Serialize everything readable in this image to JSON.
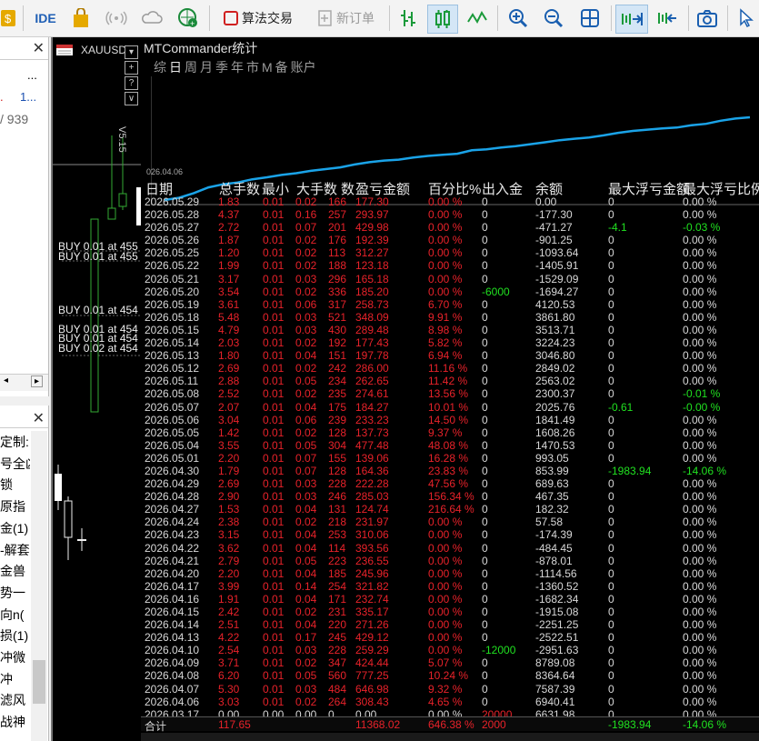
{
  "toolbar": {
    "ide": "IDE",
    "algo_trading": "算法交易",
    "new_order": "新订单"
  },
  "navigator": {
    "top_cells": [
      "...",
      "...",
      "1...",
      "1..."
    ],
    "top_fraction": "/ 939",
    "items": [
      "定制:",
      "号全凶",
      "锁",
      "原指",
      "金(1)",
      "-解套",
      "金兽",
      "势一",
      "向n(",
      "损(1)",
      "冲微",
      "冲",
      "滤风",
      "战神"
    ]
  },
  "chart": {
    "tab": "XAUUSD,H",
    "price_label": "V5.15",
    "date_label": "026.04.06",
    "orders": [
      "BUY 0.01 at 455",
      "BUY 0.01 at 455",
      "BUY 0.01 at 454",
      "BUY 0.01 at 454",
      "BUY 0.01 at 454",
      "BUY 0.02 at 454"
    ]
  },
  "stats": {
    "title": "MTCommander统计",
    "tabs": [
      "综",
      "日",
      "周",
      "月",
      "季",
      "年",
      "市",
      "M",
      "备",
      "账户"
    ],
    "active_tab": "日",
    "headers": [
      "日期",
      "总手数",
      "最小",
      "大手数",
      "数",
      "盈亏金额",
      "百分比%",
      "出入金",
      "余额",
      "最大浮亏金额",
      "最大浮亏比例"
    ],
    "rows": [
      [
        "2026.05.29",
        "1.83",
        "0.01",
        "0.02",
        "166",
        "177.30",
        "0.00 %",
        "0",
        "0.00",
        "0",
        "0.00 %"
      ],
      [
        "2026.05.28",
        "4.37",
        "0.01",
        "0.16",
        "257",
        "293.97",
        "0.00 %",
        "0",
        "-177.30",
        "0",
        "0.00 %"
      ],
      [
        "2026.05.27",
        "2.72",
        "0.01",
        "0.07",
        "201",
        "429.98",
        "0.00 %",
        "0",
        "-471.27",
        "-4.1",
        "-0.03 %"
      ],
      [
        "2026.05.26",
        "1.87",
        "0.01",
        "0.02",
        "176",
        "192.39",
        "0.00 %",
        "0",
        "-901.25",
        "0",
        "0.00 %"
      ],
      [
        "2026.05.25",
        "1.20",
        "0.01",
        "0.02",
        "113",
        "312.27",
        "0.00 %",
        "0",
        "-1093.64",
        "0",
        "0.00 %"
      ],
      [
        "2026.05.22",
        "1.99",
        "0.01",
        "0.02",
        "188",
        "123.18",
        "0.00 %",
        "0",
        "-1405.91",
        "0",
        "0.00 %"
      ],
      [
        "2026.05.21",
        "3.17",
        "0.01",
        "0.03",
        "296",
        "165.18",
        "0.00 %",
        "0",
        "-1529.09",
        "0",
        "0.00 %"
      ],
      [
        "2026.05.20",
        "3.54",
        "0.01",
        "0.02",
        "336",
        "185.20",
        "0.00 %",
        "-6000",
        "-1694.27",
        "0",
        "0.00 %"
      ],
      [
        "2026.05.19",
        "3.61",
        "0.01",
        "0.06",
        "317",
        "258.73",
        "6.70 %",
        "0",
        "4120.53",
        "0",
        "0.00 %"
      ],
      [
        "2026.05.18",
        "5.48",
        "0.01",
        "0.03",
        "521",
        "348.09",
        "9.91 %",
        "0",
        "3861.80",
        "0",
        "0.00 %"
      ],
      [
        "2026.05.15",
        "4.79",
        "0.01",
        "0.03",
        "430",
        "289.48",
        "8.98 %",
        "0",
        "3513.71",
        "0",
        "0.00 %"
      ],
      [
        "2026.05.14",
        "2.03",
        "0.01",
        "0.02",
        "192",
        "177.43",
        "5.82 %",
        "0",
        "3224.23",
        "0",
        "0.00 %"
      ],
      [
        "2026.05.13",
        "1.80",
        "0.01",
        "0.04",
        "151",
        "197.78",
        "6.94 %",
        "0",
        "3046.80",
        "0",
        "0.00 %"
      ],
      [
        "2026.05.12",
        "2.69",
        "0.01",
        "0.02",
        "242",
        "286.00",
        "11.16 %",
        "0",
        "2849.02",
        "0",
        "0.00 %"
      ],
      [
        "2026.05.11",
        "2.88",
        "0.01",
        "0.05",
        "234",
        "262.65",
        "11.42 %",
        "0",
        "2563.02",
        "0",
        "0.00 %"
      ],
      [
        "2026.05.08",
        "2.52",
        "0.01",
        "0.02",
        "235",
        "274.61",
        "13.56 %",
        "0",
        "2300.37",
        "0",
        "-0.01 %"
      ],
      [
        "2026.05.07",
        "2.07",
        "0.01",
        "0.04",
        "175",
        "184.27",
        "10.01 %",
        "0",
        "2025.76",
        "-0.61",
        "-0.00 %"
      ],
      [
        "2026.05.06",
        "3.04",
        "0.01",
        "0.06",
        "239",
        "233.23",
        "14.50 %",
        "0",
        "1841.49",
        "0",
        "0.00 %"
      ],
      [
        "2026.05.05",
        "1.42",
        "0.01",
        "0.02",
        "128",
        "137.73",
        "9.37 %",
        "0",
        "1608.26",
        "0",
        "0.00 %"
      ],
      [
        "2026.05.04",
        "3.55",
        "0.01",
        "0.05",
        "304",
        "477.48",
        "48.08 %",
        "0",
        "1470.53",
        "0",
        "0.00 %"
      ],
      [
        "2026.05.01",
        "2.20",
        "0.01",
        "0.07",
        "155",
        "139.06",
        "16.28 %",
        "0",
        "993.05",
        "0",
        "0.00 %"
      ],
      [
        "2026.04.30",
        "1.79",
        "0.01",
        "0.07",
        "128",
        "164.36",
        "23.83 %",
        "0",
        "853.99",
        "-1983.94",
        "-14.06 %"
      ],
      [
        "2026.04.29",
        "2.69",
        "0.01",
        "0.03",
        "228",
        "222.28",
        "47.56 %",
        "0",
        "689.63",
        "0",
        "0.00 %"
      ],
      [
        "2026.04.28",
        "2.90",
        "0.01",
        "0.03",
        "246",
        "285.03",
        "156.34 %",
        "0",
        "467.35",
        "0",
        "0.00 %"
      ],
      [
        "2026.04.27",
        "1.53",
        "0.01",
        "0.04",
        "131",
        "124.74",
        "216.64 %",
        "0",
        "182.32",
        "0",
        "0.00 %"
      ],
      [
        "2026.04.24",
        "2.38",
        "0.01",
        "0.02",
        "218",
        "231.97",
        "0.00 %",
        "0",
        "57.58",
        "0",
        "0.00 %"
      ],
      [
        "2026.04.23",
        "3.15",
        "0.01",
        "0.04",
        "253",
        "310.06",
        "0.00 %",
        "0",
        "-174.39",
        "0",
        "0.00 %"
      ],
      [
        "2026.04.22",
        "3.62",
        "0.01",
        "0.04",
        "114",
        "393.56",
        "0.00 %",
        "0",
        "-484.45",
        "0",
        "0.00 %"
      ],
      [
        "2026.04.21",
        "2.79",
        "0.01",
        "0.05",
        "223",
        "236.55",
        "0.00 %",
        "0",
        "-878.01",
        "0",
        "0.00 %"
      ],
      [
        "2026.04.20",
        "2.20",
        "0.01",
        "0.04",
        "185",
        "245.96",
        "0.00 %",
        "0",
        "-1114.56",
        "0",
        "0.00 %"
      ],
      [
        "2026.04.17",
        "3.99",
        "0.01",
        "0.14",
        "254",
        "321.82",
        "0.00 %",
        "0",
        "-1360.52",
        "0",
        "0.00 %"
      ],
      [
        "2026.04.16",
        "1.91",
        "0.01",
        "0.04",
        "171",
        "232.74",
        "0.00 %",
        "0",
        "-1682.34",
        "0",
        "0.00 %"
      ],
      [
        "2026.04.15",
        "2.42",
        "0.01",
        "0.02",
        "231",
        "335.17",
        "0.00 %",
        "0",
        "-1915.08",
        "0",
        "0.00 %"
      ],
      [
        "2026.04.14",
        "2.51",
        "0.01",
        "0.04",
        "220",
        "271.26",
        "0.00 %",
        "0",
        "-2251.25",
        "0",
        "0.00 %"
      ],
      [
        "2026.04.13",
        "4.22",
        "0.01",
        "0.17",
        "245",
        "429.12",
        "0.00 %",
        "0",
        "-2522.51",
        "0",
        "0.00 %"
      ],
      [
        "2026.04.10",
        "2.54",
        "0.01",
        "0.03",
        "228",
        "259.29",
        "0.00 %",
        "-12000",
        "-2951.63",
        "0",
        "0.00 %"
      ],
      [
        "2026.04.09",
        "3.71",
        "0.01",
        "0.02",
        "347",
        "424.44",
        "5.07 %",
        "0",
        "8789.08",
        "0",
        "0.00 %"
      ],
      [
        "2026.04.08",
        "6.20",
        "0.01",
        "0.05",
        "560",
        "777.25",
        "10.24 %",
        "0",
        "8364.64",
        "0",
        "0.00 %"
      ],
      [
        "2026.04.07",
        "5.30",
        "0.01",
        "0.03",
        "484",
        "646.98",
        "9.32 %",
        "0",
        "7587.39",
        "0",
        "0.00 %"
      ],
      [
        "2026.04.06",
        "3.03",
        "0.01",
        "0.02",
        "264",
        "308.43",
        "4.65 %",
        "0",
        "6940.41",
        "0",
        "0.00 %"
      ],
      [
        "2026.03.17",
        "0.00",
        "0.00",
        "0.00",
        "0",
        "0.00",
        "0.00 %",
        "20000",
        "6631.98",
        "0",
        "0.00 %"
      ]
    ],
    "total": [
      "合计",
      "117.65",
      "",
      "",
      "",
      "11368.02",
      "646.38 %",
      "2000",
      "",
      "-1983.94",
      "-14.06 %"
    ]
  },
  "colors": {
    "profit": "#e8222a",
    "neutral": "#d8d8d8",
    "green": "#20e020",
    "curve": "#1aa3e8"
  }
}
